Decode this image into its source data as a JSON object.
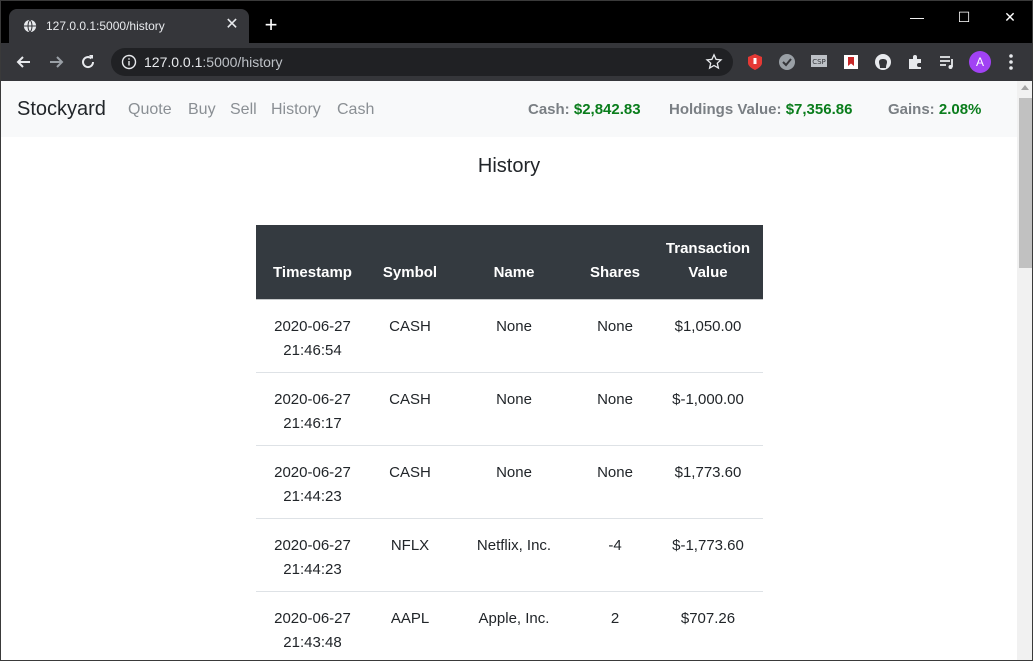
{
  "browser": {
    "tab_title": "127.0.0.1:5000/history",
    "new_tab": "+",
    "url_host": "127.0.0.1",
    "url_path": ":5000/history",
    "avatar_initial": "A",
    "window_controls": {
      "minimize": "—",
      "maximize": "☐",
      "close": "✕"
    }
  },
  "navbar": {
    "brand": "Stockyard",
    "links": [
      "Quote",
      "Buy",
      "Sell",
      "History",
      "Cash"
    ],
    "stats": [
      {
        "label": "Cash:",
        "value": "$2,842.83"
      },
      {
        "label": "Holdings Value:",
        "value": "$7,356.86"
      },
      {
        "label": "Gains:",
        "value": "2.08%"
      }
    ]
  },
  "page": {
    "title": "History"
  },
  "table": {
    "headers": [
      "Timestamp",
      "Symbol",
      "Name",
      "Shares",
      "Transaction Value"
    ],
    "rows": [
      {
        "date": "2020-06-27",
        "time": "21:46:54",
        "symbol": "CASH",
        "name": "None",
        "shares": "None",
        "value": "$1,050.00"
      },
      {
        "date": "2020-06-27",
        "time": "21:46:17",
        "symbol": "CASH",
        "name": "None",
        "shares": "None",
        "value": "$-1,000.00"
      },
      {
        "date": "2020-06-27",
        "time": "21:44:23",
        "symbol": "CASH",
        "name": "None",
        "shares": "None",
        "value": "$1,773.60"
      },
      {
        "date": "2020-06-27",
        "time": "21:44:23",
        "symbol": "NFLX",
        "name": "Netflix, Inc.",
        "shares": "-4",
        "value": "$-1,773.60"
      },
      {
        "date": "2020-06-27",
        "time": "21:43:48",
        "symbol": "AAPL",
        "name": "Apple, Inc.",
        "shares": "2",
        "value": "$707.26"
      }
    ]
  },
  "colors": {
    "gain_green": "#0a7d1c",
    "table_header": "#343a40",
    "navbar_bg": "#f8f9fa"
  },
  "icons": [
    "globe-icon",
    "back-icon",
    "forward-icon",
    "reload-icon",
    "info-icon",
    "star-icon",
    "extension-icons",
    "puzzle-icon",
    "menu-icon"
  ]
}
